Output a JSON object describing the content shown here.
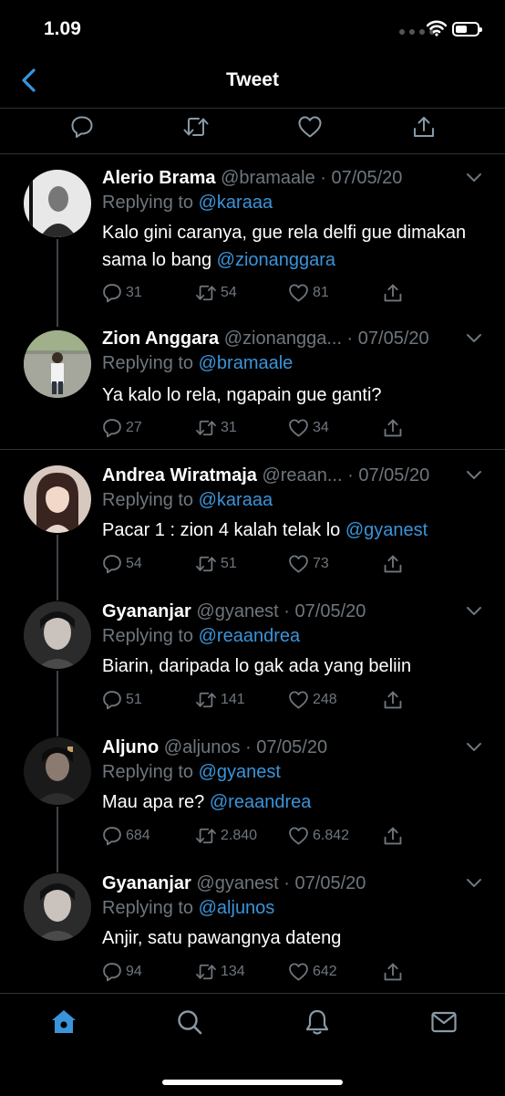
{
  "status": {
    "time": "1.09"
  },
  "nav": {
    "title": "Tweet"
  },
  "tweets": [
    {
      "name": "Alerio Brama",
      "handle": "@bramaale",
      "date": "07/05/20",
      "reply_prefix": "Replying to ",
      "reply_to": "@karaaa",
      "body_text": "Kalo gini caranya, gue rela delfi gue dimakan sama lo bang ",
      "body_mention": "@zionanggara",
      "replies": "31",
      "retweets": "54",
      "likes": "81"
    },
    {
      "name": "Zion Anggara",
      "handle": "@zionangga...",
      "date": "07/05/20",
      "reply_prefix": "Replying to ",
      "reply_to": "@bramaale",
      "body_text": "Ya kalo lo rela, ngapain gue ganti?",
      "body_mention": "",
      "replies": "27",
      "retweets": "31",
      "likes": "34"
    },
    {
      "name": "Andrea Wiratmaja",
      "handle": "@reaan...",
      "date": "07/05/20",
      "reply_prefix": "Replying to ",
      "reply_to": "@karaaa",
      "body_text": "Pacar 1 : zion 4 kalah telak lo ",
      "body_mention": "@gyanest",
      "replies": "54",
      "retweets": "51",
      "likes": "73"
    },
    {
      "name": "Gyananjar",
      "handle": "@gyanest",
      "date": "07/05/20",
      "reply_prefix": "Replying to ",
      "reply_to": "@reaandrea",
      "body_text": "Biarin, daripada lo gak ada yang beliin",
      "body_mention": "",
      "replies": "51",
      "retweets": "141",
      "likes": "248"
    },
    {
      "name": "Aljuno",
      "handle": "@aljunos",
      "date": "07/05/20",
      "reply_prefix": "Replying to ",
      "reply_to": "@gyanest",
      "body_text": "Mau apa re? ",
      "body_mention": "@reaandrea",
      "replies": "684",
      "retweets": "2.840",
      "likes": "6.842"
    },
    {
      "name": "Gyananjar",
      "handle": "@gyanest",
      "date": "07/05/20",
      "reply_prefix": "Replying to ",
      "reply_to": "@aljunos",
      "body_text": "Anjir, satu pawangnya dateng",
      "body_mention": "",
      "replies": "94",
      "retweets": "134",
      "likes": "642"
    }
  ],
  "colors": {
    "accent": "#3b94d9",
    "muted": "#6e767d",
    "background": "#000000",
    "divider": "#2f3336"
  },
  "icons": {
    "actionbar": [
      "reply-icon",
      "retweet-icon",
      "like-icon",
      "share-icon"
    ],
    "tabbar": [
      "home-icon",
      "search-icon",
      "notifications-icon",
      "messages-icon"
    ]
  }
}
